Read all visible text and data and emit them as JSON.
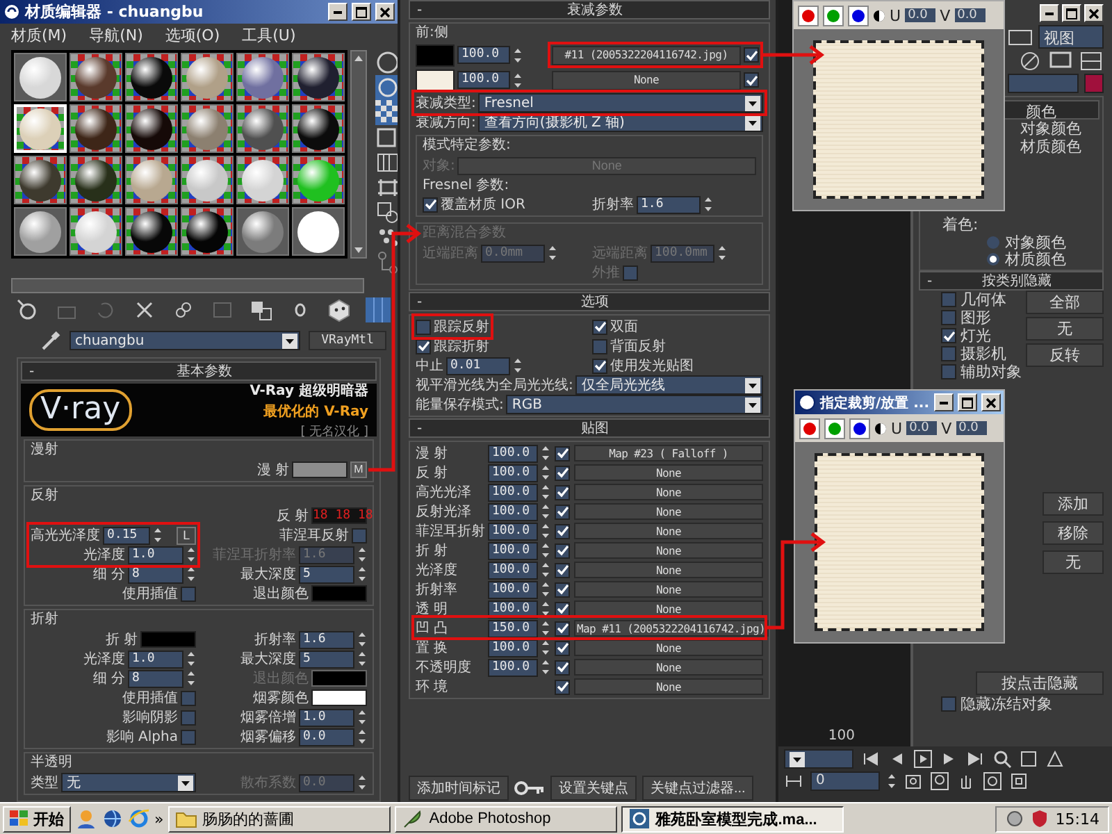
{
  "material_editor": {
    "title": "材质编辑器 - chuangbu",
    "menu": [
      "材质(M)",
      "导航(N)",
      "选项(O)",
      "工具(U)"
    ],
    "slots": [
      {
        "color": "#d8d8d8",
        "kind": "plain",
        "selected": false
      },
      {
        "color": "#5a3a2c",
        "kind": "checker",
        "selected": false
      },
      {
        "color": "#0a0a0a",
        "kind": "checker",
        "selected": false
      },
      {
        "color": "#b0a088",
        "kind": "checker",
        "selected": false
      },
      {
        "color": "#7070a0",
        "kind": "checker",
        "selected": false
      },
      {
        "color": "#202030",
        "kind": "checker",
        "selected": false
      },
      {
        "color": "#dcd0b8",
        "kind": "checker",
        "selected": true
      },
      {
        "color": "#3e2618",
        "kind": "checker",
        "selected": false
      },
      {
        "color": "#160a08",
        "kind": "checker",
        "selected": false
      },
      {
        "color": "#8c8070",
        "kind": "checker",
        "selected": false
      },
      {
        "color": "#505050",
        "kind": "checker",
        "selected": false
      },
      {
        "color": "#0c0c0c",
        "kind": "checker",
        "selected": false
      },
      {
        "color": "#3e3a2e",
        "kind": "checker",
        "selected": false
      },
      {
        "color": "#28301a",
        "kind": "checker",
        "selected": false
      },
      {
        "color": "#b8a890",
        "kind": "checker",
        "selected": false
      },
      {
        "color": "#c8c8c8",
        "kind": "checker",
        "selected": false
      },
      {
        "color": "#d4d4d4",
        "kind": "checker",
        "selected": false
      },
      {
        "color": "#20c020",
        "kind": "checker",
        "selected": false
      },
      {
        "color": "#a0a0a0",
        "kind": "plain",
        "selected": false
      },
      {
        "color": "#d4d4d4",
        "kind": "checker",
        "selected": false
      },
      {
        "color": "#080808",
        "kind": "checker",
        "selected": false
      },
      {
        "color": "#050505",
        "kind": "checker",
        "selected": false
      },
      {
        "color": "#7c7c7c",
        "kind": "plain",
        "selected": false
      },
      {
        "color": "#ffffff",
        "kind": "plain",
        "selected": false
      }
    ],
    "material_name": "chuangbu",
    "material_type": "VRayMtl",
    "rollout": {
      "toggle": "-",
      "title": "基本参数"
    },
    "banner": {
      "logo": "V·ray",
      "title": "V-Ray 超级明暗器",
      "subtitle": "最优化的 V-Ray",
      "credit": "[ 无名汉化 ]"
    },
    "groups": [
      {
        "title": "漫射",
        "rows": [
          {
            "left": {
              "kind": "swatch",
              "label": "漫 射",
              "color": "#8c8c8c",
              "map": "M"
            }
          }
        ]
      },
      {
        "title": "反射",
        "rows": [
          {
            "left": {
              "kind": "swatch",
              "label": "反 射",
              "color": "#121212",
              "value": "18 18 18"
            }
          },
          {
            "left": {
              "kind": "spinner",
              "label": "高光光泽度",
              "value": "0.15",
              "lock": "L"
            },
            "right": {
              "kind": "check",
              "label": "菲涅耳反射",
              "checked": false
            }
          },
          {
            "left": {
              "kind": "spinner",
              "label": "光泽度",
              "value": "1.0"
            },
            "right": {
              "kind": "spinner",
              "label": "菲涅耳折射率",
              "value": "1.6",
              "disabled": true
            }
          },
          {
            "left": {
              "kind": "spinner",
              "label": "细 分",
              "value": "8"
            },
            "right": {
              "kind": "spinner",
              "label": "最大深度",
              "value": "5"
            }
          },
          {
            "left": {
              "kind": "check",
              "label": "使用插值",
              "checked": false
            },
            "right": {
              "kind": "swatch",
              "label": "退出颜色",
              "color": "#000000"
            }
          }
        ]
      },
      {
        "title": "折射",
        "rows": [
          {
            "left": {
              "kind": "swatch",
              "label": "折 射",
              "color": "#000000"
            },
            "right": {
              "kind": "spinner",
              "label": "折射率",
              "value": "1.6"
            }
          },
          {
            "left": {
              "kind": "spinner",
              "label": "光泽度",
              "value": "1.0"
            },
            "right": {
              "kind": "spinner",
              "label": "最大深度",
              "value": "5"
            }
          },
          {
            "left": {
              "kind": "spinner",
              "label": "细 分",
              "value": "8"
            },
            "right": {
              "kind": "swatch",
              "label": "退出颜色",
              "color": "#000000",
              "disabled": true
            }
          },
          {
            "left": {
              "kind": "check",
              "label": "使用插值",
              "checked": false
            },
            "right": {
              "kind": "swatch",
              "label": "烟雾颜色",
              "color": "#ffffff"
            }
          },
          {
            "left": {
              "kind": "check",
              "label": "影响阴影",
              "checked": false
            },
            "right": {
              "kind": "spinner",
              "label": "烟雾倍增",
              "value": "1.0"
            }
          },
          {
            "left": {
              "kind": "check",
              "label": "影响 Alpha",
              "checked": false
            },
            "right": {
              "kind": "spinner",
              "label": "烟雾偏移",
              "value": "0.0"
            }
          }
        ]
      },
      {
        "title": "半透明",
        "rows": [
          {
            "left": {
              "kind": "dropdown",
              "label": "类型",
              "value": "无"
            },
            "right": {
              "kind": "spinner",
              "label": "散布系数",
              "value": "0.0",
              "disabled": true
            }
          }
        ]
      }
    ]
  },
  "falloff_rollout": {
    "toggle": "-",
    "title": "衰减参数",
    "group_title": "前:侧",
    "map_rows": [
      {
        "color": "#000000",
        "amount": "100.0",
        "map": "#11 (2005322204116742.jpg)",
        "checked": true
      },
      {
        "color": "#f5efe2",
        "amount": "100.0",
        "map": "None",
        "checked": true
      }
    ],
    "groups": [
      {
        "rows": [
          {
            "left": {
              "kind": "dropdown",
              "label": "衰减类型:",
              "value": "Fresnel"
            }
          },
          {
            "left": {
              "kind": "dropdown",
              "label": "衰减方向:",
              "value": "查看方向(摄影机 Z 轴)"
            }
          }
        ]
      },
      {
        "title": "模式特定参数:",
        "rows": [
          {
            "left": {
              "kind": "button",
              "label": "对象:",
              "value": "None",
              "disabled": true
            }
          },
          {
            "left": {
              "kind": "text",
              "value": "Fresnel 参数:"
            }
          },
          {
            "left": {
              "kind": "box",
              "label": "覆盖材质 IOR",
              "checked": true
            },
            "right": {
              "kind": "spinner",
              "label": "折射率",
              "value": "1.6"
            }
          }
        ]
      },
      {
        "title": "距离混合参数",
        "disabled": true,
        "rows": [
          {
            "left": {
              "kind": "spinner",
              "label": "近端距离",
              "value": "0.0mm",
              "disabled": true
            },
            "right": {
              "kind": "spinner",
              "label": "远端距离",
              "value": "100.0mm",
              "disabled": true
            }
          },
          {
            "right": {
              "kind": "check",
              "label": "外推",
              "checked": false,
              "disabled": true
            }
          }
        ]
      }
    ]
  },
  "options_rollout": {
    "toggle": "-",
    "title": "选项",
    "rows": [
      {
        "left": {
          "kind": "box",
          "label": "跟踪反射",
          "checked": false
        },
        "right": {
          "kind": "box",
          "label": "双面",
          "checked": true
        }
      },
      {
        "left": {
          "kind": "box",
          "label": "跟踪折射",
          "checked": true
        },
        "right": {
          "kind": "box",
          "label": "背面反射",
          "checked": false
        }
      },
      {
        "left": {
          "kind": "spinner",
          "label": "中止",
          "value": "0.01"
        },
        "right": {
          "kind": "box",
          "label": "使用发光贴图",
          "checked": true
        }
      },
      {
        "left": {
          "kind": "dropdown",
          "label": "视平滑光线为全局光光线:",
          "value": "仅全局光光线"
        }
      },
      {
        "left": {
          "kind": "dropdown",
          "label": "能量保存模式:",
          "value": "RGB"
        }
      }
    ]
  },
  "maps_rollout": {
    "toggle": "-",
    "title": "贴图",
    "rows": [
      {
        "label": "漫 射",
        "amount": "100.0",
        "checked": true,
        "map": "Map #23  ( Falloff )"
      },
      {
        "label": "反 射",
        "amount": "100.0",
        "checked": true,
        "map": "None"
      },
      {
        "label": "高光光泽",
        "amount": "100.0",
        "checked": true,
        "map": "None"
      },
      {
        "label": "反射光泽",
        "amount": "100.0",
        "checked": true,
        "map": "None"
      },
      {
        "label": "菲涅耳折射",
        "amount": "100.0",
        "checked": true,
        "map": "None"
      },
      {
        "label": "折 射",
        "amount": "100.0",
        "checked": true,
        "map": "None"
      },
      {
        "label": "光泽度",
        "amount": "100.0",
        "checked": true,
        "map": "None"
      },
      {
        "label": "折射率",
        "amount": "100.0",
        "checked": true,
        "map": "None"
      },
      {
        "label": "透 明",
        "amount": "100.0",
        "checked": true,
        "map": "None"
      },
      {
        "label": "凹 凸",
        "amount": "150.0",
        "checked": true,
        "map": "Map #11 (2005322204116742.jpg)"
      },
      {
        "label": "置 换",
        "amount": "100.0",
        "checked": true,
        "map": "None"
      },
      {
        "label": "不透明度",
        "amount": "100.0",
        "checked": true,
        "map": "None"
      },
      {
        "label": "环 境",
        "checked": true,
        "map": "None"
      }
    ]
  },
  "animation_bar": {
    "time_tag": "添加时间标记",
    "set_key": "设置关键点",
    "key_filters": "关键点过滤器..."
  },
  "command_panel": {
    "view_field": "视图",
    "object_swatch": {
      "color": "#a0103c"
    },
    "color_rollout": "颜色",
    "wire_options": [
      "对象颜色",
      "材质颜色"
    ],
    "shaded_label": "着色:",
    "shaded_options": [
      {
        "label": "对象颜色",
        "selected": false
      },
      {
        "label": "材质颜色",
        "selected": true
      }
    ],
    "category_rollout": {
      "toggle": "-",
      "title": "按类别隐藏",
      "items": [
        {
          "label": "几何体",
          "checked": false
        },
        {
          "label": "图形",
          "checked": false
        },
        {
          "label": "灯光",
          "checked": true
        },
        {
          "label": "摄影机",
          "checked": false
        },
        {
          "label": "辅助对象",
          "checked": false
        }
      ],
      "buttons": [
        "全部",
        "无",
        "反转"
      ]
    },
    "list_buttons": [
      "添加",
      "移除",
      "无"
    ],
    "hide_button": "按点击隐藏",
    "hide_frozen": {
      "label": "隐藏冻结对象",
      "checked": false
    }
  },
  "timeline": {
    "end_label": "100",
    "frame": "0"
  },
  "texture_windows": [
    {
      "u_label": "U",
      "u": "0.0",
      "v_label": "V",
      "v": "0.0"
    },
    {
      "title": "指定裁剪/放置 ...",
      "u_label": "U",
      "u": "0.0",
      "v_label": "V",
      "v": "0.0"
    }
  ],
  "taskbar": {
    "start": "开始",
    "more": "»",
    "tasks": [
      {
        "kind": "folder",
        "label": "肠肠的的蔷圃",
        "selected": false
      },
      {
        "kind": "photoshop",
        "label": "Adobe Photoshop",
        "selected": false
      },
      {
        "kind": "max",
        "label": "雅苑卧室模型完成.ma...",
        "selected": true
      }
    ],
    "clock": "15:14"
  }
}
